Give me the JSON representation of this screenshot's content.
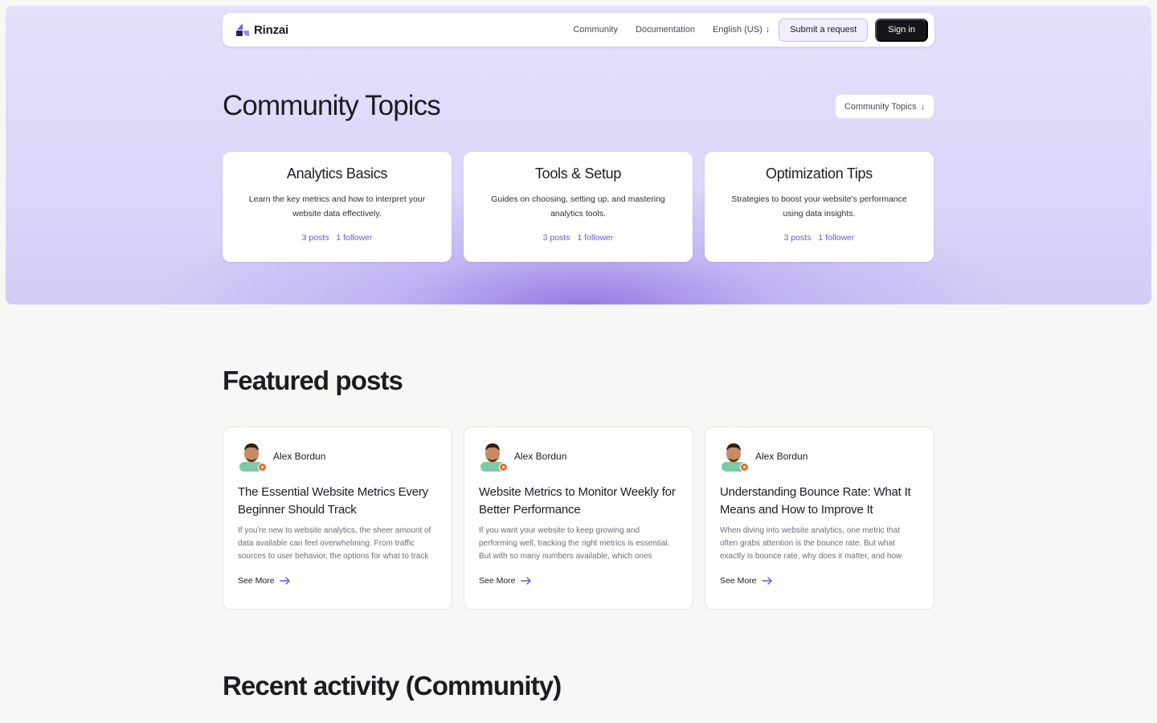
{
  "header": {
    "brand": "Rinzai",
    "nav": {
      "community": "Community",
      "documentation": "Documentation",
      "language": "English (US)"
    },
    "submit_request": "Submit a request",
    "sign_in": "Sign in"
  },
  "hero": {
    "title": "Community Topics",
    "dropdown": "Community Topics",
    "topics": [
      {
        "title": "Analytics Basics",
        "description": "Learn the key metrics and how to interpret your website data effectively.",
        "posts": "3 posts",
        "followers": "1 follower"
      },
      {
        "title": "Tools & Setup",
        "description": "Guides on choosing, setting up, and mastering analytics tools.",
        "posts": "3 posts",
        "followers": "1 follower"
      },
      {
        "title": "Optimization Tips",
        "description": "Strategies to boost your website's performance using data insights.",
        "posts": "3 posts",
        "followers": "1 follower"
      }
    ]
  },
  "featured": {
    "title": "Featured posts",
    "see_more": "See More",
    "posts": [
      {
        "author": "Alex Bordun",
        "title": "The Essential Website Metrics Every Beginner Should Track",
        "excerpt": "If you're new to website analytics, the sheer amount of data available can feel overwhelming. From traffic sources to user behavior, the options for what to track"
      },
      {
        "author": "Alex Bordun",
        "title": "Website Metrics to Monitor Weekly for Better Performance",
        "excerpt": "If you want your website to keep growing and performing well, tracking the right metrics is essential. But with so many numbers available, which ones"
      },
      {
        "author": "Alex Bordun",
        "title": "Understanding Bounce Rate: What It Means and How to Improve It",
        "excerpt": "When diving into website analytics, one metric that often grabs attention is the bounce rate. But what exactly is bounce rate, why does it matter, and how"
      }
    ]
  },
  "recent": {
    "title": "Recent activity (Community)"
  },
  "colors": {
    "accent": "#6b55d6",
    "dark": "#16161a",
    "hero_bg": "#ddd8fa",
    "badge": "#ef6a2b"
  }
}
